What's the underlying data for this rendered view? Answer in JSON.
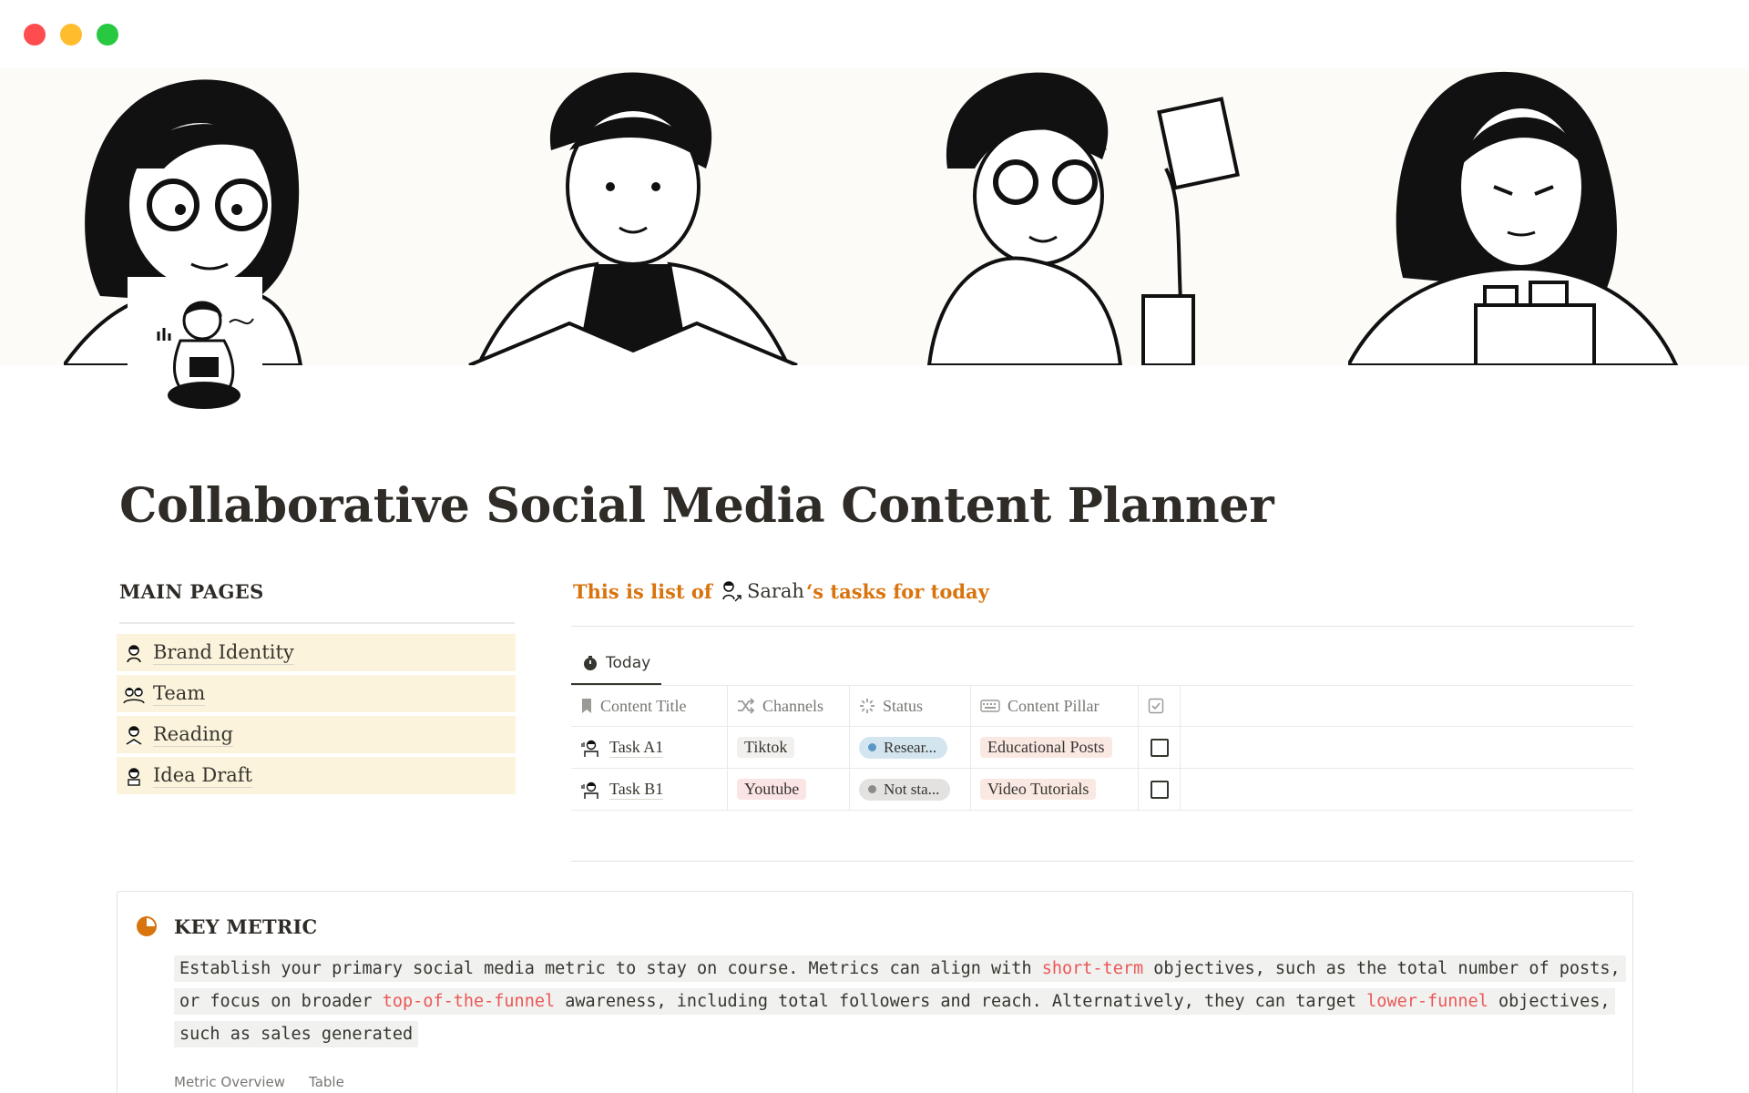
{
  "window": {
    "controls": [
      "close",
      "minimize",
      "maximize"
    ]
  },
  "cover": {
    "description_icons": [
      "woman-glasses-illustration",
      "man-reading-illustration",
      "man-notes-illustration",
      "woman-files-illustration"
    ]
  },
  "page_icon": "woman-laptop-icon",
  "title": "Collaborative Social Media Content Planner",
  "main_pages": {
    "heading": "MAIN PAGES",
    "items": [
      {
        "label": "Brand Identity",
        "icon": "person-avatar-icon"
      },
      {
        "label": "Team",
        "icon": "team-avatar-icon"
      },
      {
        "label": "Reading",
        "icon": "reader-avatar-icon"
      },
      {
        "label": "Idea Draft",
        "icon": "drafter-avatar-icon"
      }
    ]
  },
  "tasks": {
    "prefix": "This is list of",
    "mention": "Sarah",
    "suffix": "‘s tasks for today",
    "tab": {
      "label": "Today",
      "icon": "clock-icon"
    },
    "columns": [
      {
        "label": "Content Title",
        "icon": "bookmark-icon"
      },
      {
        "label": "Channels",
        "icon": "shuffle-icon"
      },
      {
        "label": "Status",
        "icon": "loading-icon"
      },
      {
        "label": "Content Pillar",
        "icon": "keyboard-icon"
      },
      {
        "label": "",
        "icon": "checkbox-icon"
      }
    ],
    "rows": [
      {
        "title": "Task A1",
        "channel": "Tiktok",
        "status": "Resear...",
        "pillar": "Educational Posts",
        "done": false
      },
      {
        "title": "Task B1",
        "channel": "Youtube",
        "status": "Not sta...",
        "pillar": "Video Tutorials",
        "done": false
      }
    ]
  },
  "callout": {
    "icon": "pie-chart-icon",
    "title": "KEY METRIC",
    "text_1": "Establish your primary social media metric to stay on course. Metrics can align with ",
    "hl_1": "short-term",
    "text_2": " objectives, such as the total number of posts, or focus on broader ",
    "hl_2": "top-of-the-funnel",
    "text_3": " awareness, including total followers and reach. Alternatively, they can target ",
    "hl_3": "lower-funnel",
    "text_4": " objectives, such as sales generated",
    "footer_items": [
      "Metric Overview",
      "Table"
    ]
  },
  "colors": {
    "accent_orange": "#d9730d",
    "highlight_red": "#eb5757",
    "main_pages_bg": "#fbf3db",
    "status_blue": "#d3e5ef",
    "status_gray": "#e3e2e0"
  }
}
